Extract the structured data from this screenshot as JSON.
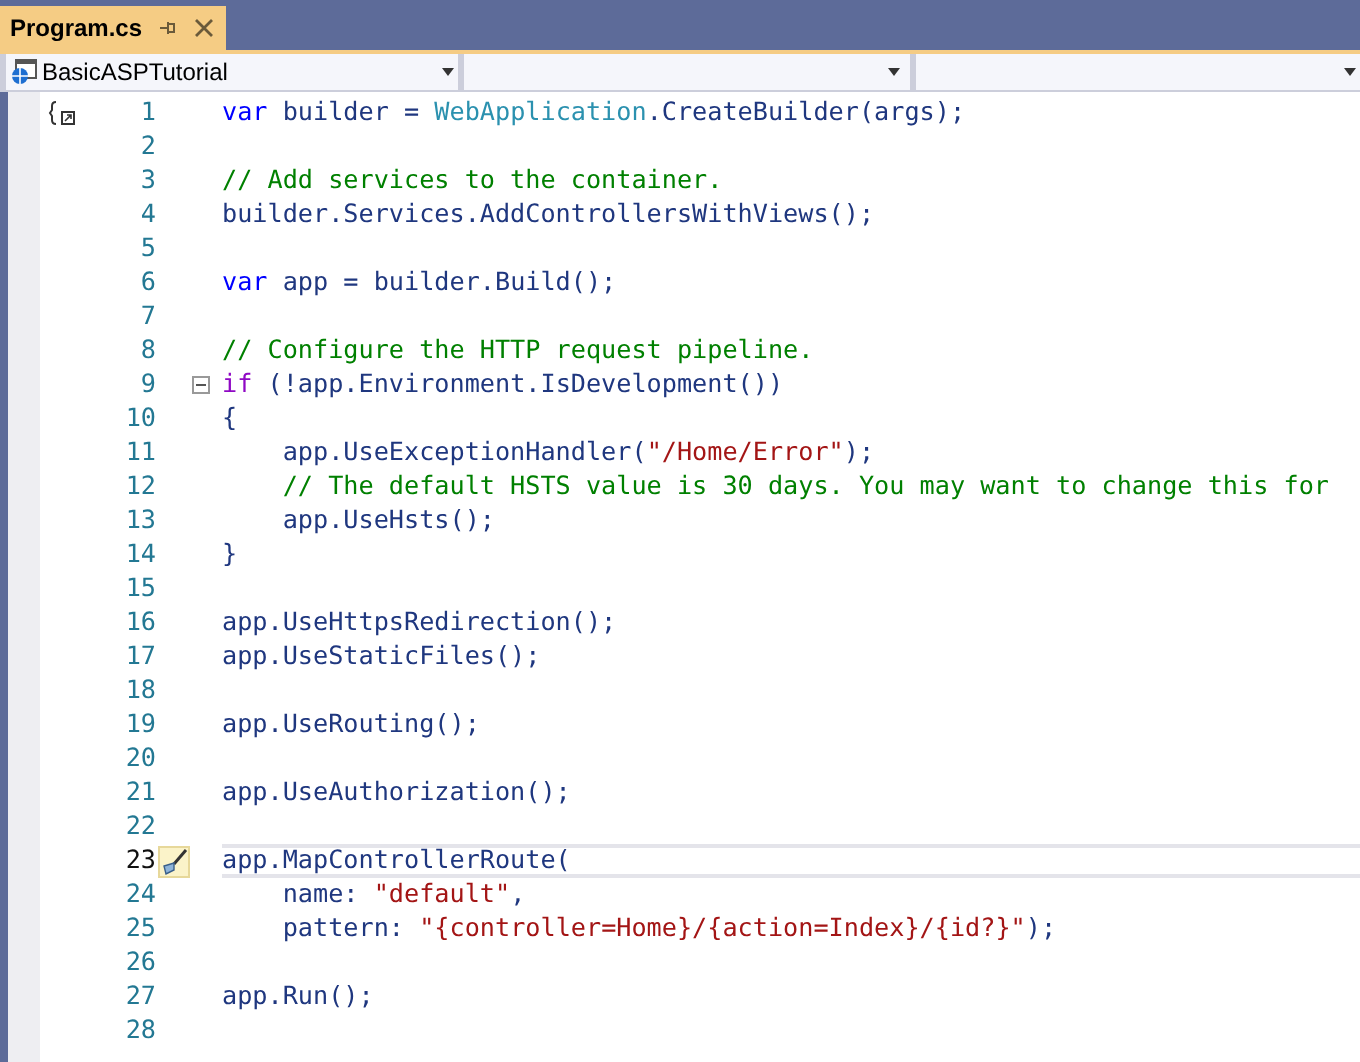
{
  "tab": {
    "title": "Program.cs",
    "selected": true
  },
  "navigation_bar": {
    "project": "BasicASPTutorial"
  },
  "editor": {
    "lines": [
      {
        "number": "1",
        "scope_marker": true,
        "tokens": [
          {
            "kind": "keyword",
            "text": "var"
          },
          {
            "kind": "plain",
            "text": " builder = "
          },
          {
            "kind": "type",
            "text": "WebApplication"
          },
          {
            "kind": "plain",
            "text": ".CreateBuilder(args);"
          }
        ]
      },
      {
        "number": "2"
      },
      {
        "number": "3",
        "tokens": [
          {
            "kind": "comment",
            "text": "// Add services to the container."
          }
        ]
      },
      {
        "number": "4",
        "tokens": [
          {
            "kind": "plain",
            "text": "builder.Services.AddControllersWithViews();"
          }
        ]
      },
      {
        "number": "5"
      },
      {
        "number": "6",
        "tokens": [
          {
            "kind": "keyword",
            "text": "var"
          },
          {
            "kind": "plain",
            "text": " app = builder.Build();"
          }
        ]
      },
      {
        "number": "7"
      },
      {
        "number": "8",
        "tokens": [
          {
            "kind": "comment",
            "text": "// Configure the HTTP request pipeline."
          }
        ]
      },
      {
        "number": "9",
        "expanded": true,
        "tokens": [
          {
            "kind": "control",
            "text": "if"
          },
          {
            "kind": "plain",
            "text": " (!app.Environment.IsDevelopment())"
          }
        ]
      },
      {
        "number": "10",
        "tokens": [
          {
            "kind": "plain",
            "text": "{"
          }
        ]
      },
      {
        "number": "11",
        "tokens": [
          {
            "kind": "plain",
            "text": "    app.UseExceptionHandler("
          },
          {
            "kind": "string",
            "text": "\"/Home/Error\""
          },
          {
            "kind": "plain",
            "text": ");"
          }
        ]
      },
      {
        "number": "12",
        "tokens": [
          {
            "kind": "comment",
            "text": "    // The default HSTS value is 30 days. You may want to change this for"
          }
        ]
      },
      {
        "number": "13",
        "tokens": [
          {
            "kind": "plain",
            "text": "    app.UseHsts();"
          }
        ]
      },
      {
        "number": "14",
        "tokens": [
          {
            "kind": "plain",
            "text": "}"
          }
        ]
      },
      {
        "number": "15"
      },
      {
        "number": "16",
        "tokens": [
          {
            "kind": "plain",
            "text": "app.UseHttpsRedirection();"
          }
        ]
      },
      {
        "number": "17",
        "tokens": [
          {
            "kind": "plain",
            "text": "app.UseStaticFiles();"
          }
        ]
      },
      {
        "number": "18"
      },
      {
        "number": "19",
        "tokens": [
          {
            "kind": "plain",
            "text": "app.UseRouting();"
          }
        ]
      },
      {
        "number": "20"
      },
      {
        "number": "21",
        "tokens": [
          {
            "kind": "plain",
            "text": "app.UseAuthorization();"
          }
        ]
      },
      {
        "number": "22"
      },
      {
        "number": "23",
        "current": true,
        "quick_action": true,
        "tokens": [
          {
            "kind": "plain",
            "text": "app.MapControllerRoute("
          }
        ]
      },
      {
        "number": "24",
        "tokens": [
          {
            "kind": "plain",
            "text": "    name: "
          },
          {
            "kind": "string",
            "text": "\"default\""
          },
          {
            "kind": "plain",
            "text": ","
          }
        ]
      },
      {
        "number": "25",
        "tokens": [
          {
            "kind": "plain",
            "text": "    pattern: "
          },
          {
            "kind": "string",
            "text": "\"{controller=Home}/{action=Index}/{id?}\""
          },
          {
            "kind": "plain",
            "text": ");"
          }
        ]
      },
      {
        "number": "26"
      },
      {
        "number": "27",
        "tokens": [
          {
            "kind": "plain",
            "text": "app.Run();"
          }
        ]
      },
      {
        "number": "28"
      }
    ]
  }
}
